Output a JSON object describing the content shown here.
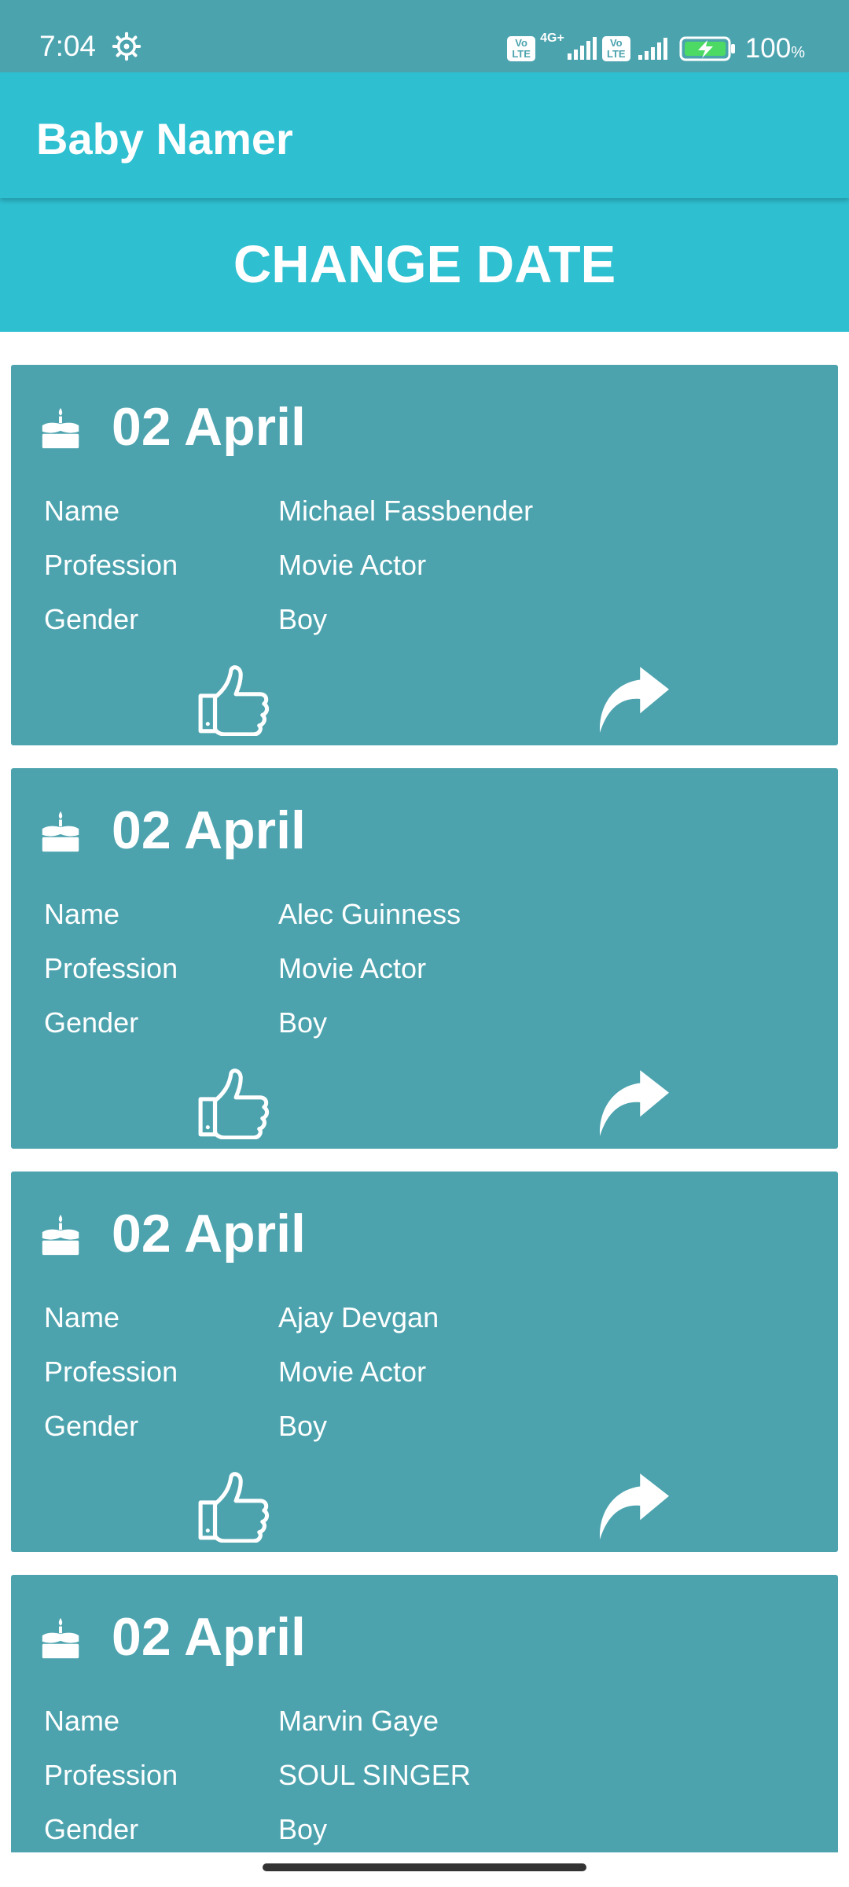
{
  "status_bar": {
    "time": "7:04",
    "volte_label": "Vo LTE",
    "network_label": "4G+",
    "battery_percent": "100",
    "battery_unit": "%"
  },
  "app_bar": {
    "title": "Baby Namer"
  },
  "actions": {
    "change_date_label": "CHANGE DATE"
  },
  "labels": {
    "name": "Name",
    "profession": "Profession",
    "gender": "Gender"
  },
  "cards": [
    {
      "date": "02 April",
      "name": "Michael Fassbender",
      "profession": "Movie Actor",
      "gender": "Boy"
    },
    {
      "date": "02 April",
      "name": "Alec Guinness",
      "profession": "Movie Actor",
      "gender": "Boy"
    },
    {
      "date": "02 April",
      "name": "Ajay Devgan",
      "profession": "Movie Actor",
      "gender": "Boy"
    },
    {
      "date": "02 April",
      "name": "Marvin Gaye",
      "profession": "SOUL SINGER",
      "gender": "Boy"
    }
  ],
  "colors": {
    "status_bar": "#4ba3ae",
    "app_bar": "#2ebfd1",
    "card": "#4ca3ae",
    "text": "#ffffff"
  },
  "icons": {
    "card_header": "cake-icon",
    "like": "thumbs-up-icon",
    "share": "share-arrow-icon",
    "status": "gear-icon"
  }
}
